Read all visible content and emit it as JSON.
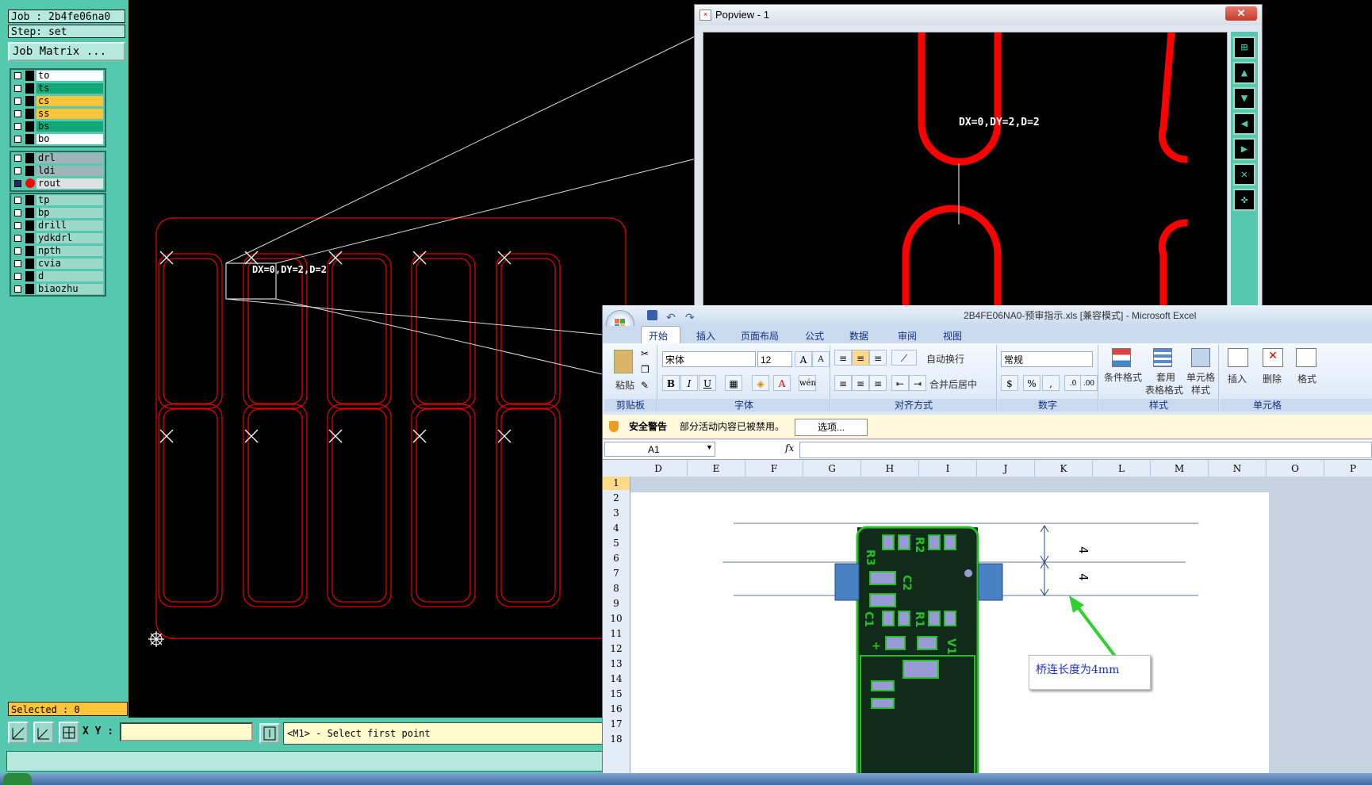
{
  "left_panel": {
    "job": "Job : 2b4fe06na0",
    "step": "Step: set",
    "job_matrix_button": "Job Matrix ...",
    "layer_groups": [
      [
        {
          "name": "to",
          "color": "#ffffff"
        },
        {
          "name": "ts",
          "color": "#10a878"
        },
        {
          "name": "cs",
          "color": "#ffc43a"
        },
        {
          "name": "ss",
          "color": "#ffc43a"
        },
        {
          "name": "bs",
          "color": "#10a878"
        },
        {
          "name": "bo",
          "color": "#ffffff"
        }
      ],
      [
        {
          "name": "drl",
          "color": "#9fb6b8"
        },
        {
          "name": "ldi",
          "color": "#9fb6b8"
        },
        {
          "name": "rout",
          "color": "#e0e0e0",
          "active": true
        }
      ],
      [
        {
          "name": "tp",
          "color": "#9cd9c9"
        },
        {
          "name": "bp",
          "color": "#9cd9c9"
        },
        {
          "name": "drill",
          "color": "#9cd9c9"
        },
        {
          "name": "ydkdrl",
          "color": "#9cd9c9"
        },
        {
          "name": "npth",
          "color": "#9cd9c9"
        },
        {
          "name": "cvia",
          "color": "#9cd9c9"
        },
        {
          "name": "d",
          "color": "#9cd9c9"
        },
        {
          "name": "biaozhu",
          "color": "#9cd9c9"
        }
      ]
    ],
    "selected": "Selected : 0"
  },
  "bottom_bar": {
    "xy_label": "X Y :",
    "xy_value": "",
    "message": "<M1> - Select first point"
  },
  "canvas": {
    "measure_text": "DX=0,DY=2,D=2"
  },
  "popview": {
    "title": "Popview - 1",
    "close": "✕",
    "measure_text": "DX=0,DY=2,D=2"
  },
  "excel": {
    "title": "2B4FE06NA0-预审指示.xls  [兼容模式] - Microsoft Excel",
    "tabs": [
      "开始",
      "插入",
      "页面布局",
      "公式",
      "数据",
      "审阅",
      "视图"
    ],
    "ribbon": {
      "paste": "粘贴",
      "clipboard": "剪贴板",
      "font_name": "宋体",
      "font_size": "12",
      "font_group": "字体",
      "wrap": "自动换行",
      "merge": "合并后居中",
      "align_group": "对齐方式",
      "number_format": "常规",
      "number_group": "数字",
      "cond_format": "条件格式",
      "table_format_1": "套用",
      "table_format_2": "表格格式",
      "cell_style_1": "单元格",
      "cell_style_2": "样式",
      "style_group": "样式",
      "insert": "插入",
      "delete": "删除",
      "format": "格式",
      "cells_group": "单元格"
    },
    "security": {
      "label": "安全警告",
      "text": "部分活动内容已被禁用。",
      "button": "选项..."
    },
    "name_box": "A1",
    "fx": "fx",
    "columns": [
      "D",
      "E",
      "F",
      "G",
      "H",
      "I",
      "J",
      "K",
      "L",
      "M",
      "N",
      "O",
      "P"
    ],
    "rows": [
      "1",
      "2",
      "3",
      "4",
      "5",
      "6",
      "7",
      "8",
      "9",
      "10",
      "11",
      "12",
      "13",
      "14",
      "15",
      "16",
      "17",
      "18"
    ],
    "dim_labels": [
      "4",
      "4"
    ],
    "note": "桥连长度为4mm",
    "pcb_labels": [
      "R3",
      "R2",
      "C2",
      "C1",
      "R1",
      "V1",
      "+"
    ]
  }
}
